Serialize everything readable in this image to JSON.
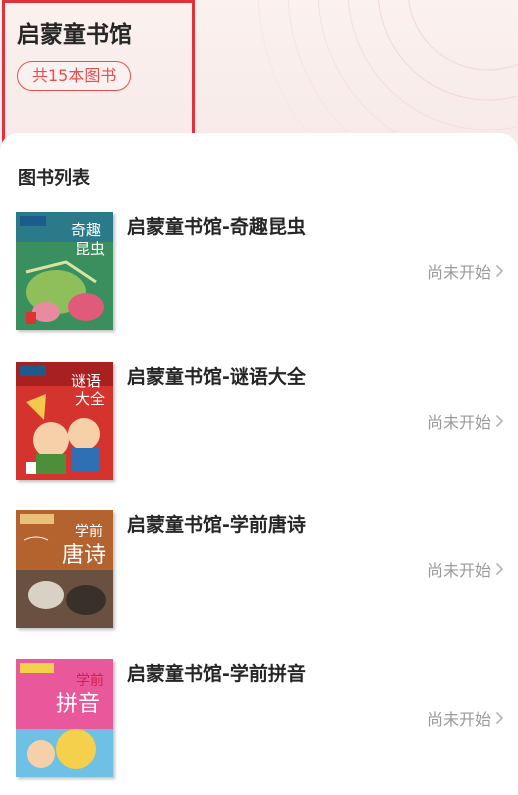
{
  "header": {
    "title": "启蒙童书馆",
    "count_label": "共15本图书"
  },
  "list": {
    "section_title": "图书列表",
    "books": [
      {
        "title": "启蒙童书馆-奇趣昆虫",
        "status": "尚未开始",
        "cover_text": "奇趣昆虫",
        "cover_colors": [
          "#2f8a5a",
          "#d9e3a0",
          "#e05a79"
        ]
      },
      {
        "title": "启蒙童书馆-谜语大全",
        "status": "尚未开始",
        "cover_text": "谜语大全",
        "cover_colors": [
          "#d4342d",
          "#f2c94c",
          "#4b8f3a"
        ]
      },
      {
        "title": "启蒙童书馆-学前唐诗",
        "status": "尚未开始",
        "cover_text": "学前唐诗",
        "cover_colors": [
          "#b4622e",
          "#e8c27a",
          "#5a4a3c"
        ]
      },
      {
        "title": "启蒙童书馆-学前拼音",
        "status": "尚未开始",
        "cover_text": "学前拼音",
        "cover_colors": [
          "#e8589a",
          "#6ec1e4",
          "#f5d04c"
        ]
      }
    ]
  },
  "colors": {
    "accent": "#e4514f",
    "highlight": "#e0323a",
    "status_gray": "#9a9a9a"
  }
}
